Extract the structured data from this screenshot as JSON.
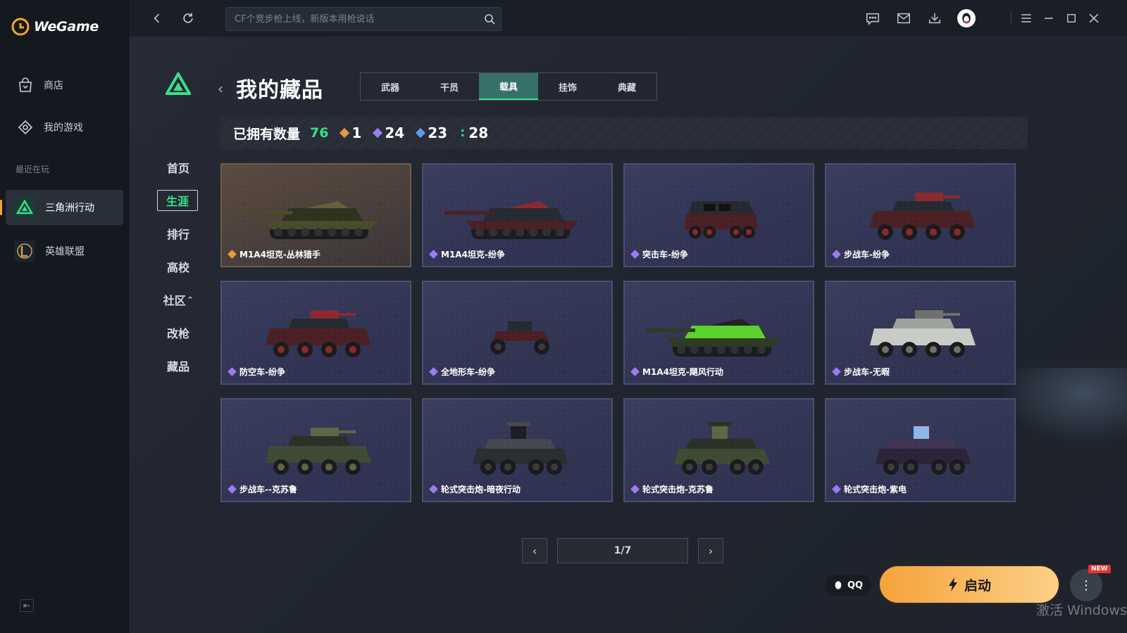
{
  "app": {
    "name": "WeGame"
  },
  "sidebar": {
    "items": [
      {
        "label": "商店",
        "icon": "shop-bag-icon"
      },
      {
        "label": "我的游戏",
        "icon": "my-games-icon"
      }
    ],
    "recent_label": "最近在玩",
    "recent": [
      {
        "label": "三角洲行动",
        "icon": "delta-force-icon",
        "active": true
      },
      {
        "label": "英雄联盟",
        "icon": "league-of-legends-icon",
        "active": false
      }
    ]
  },
  "topbar": {
    "search_placeholder": "CF个竞步枪上线，新版本用枪说话"
  },
  "game_nav": {
    "items": [
      "首页",
      "生涯",
      "排行",
      "高校",
      "社区",
      "改枪",
      "藏品"
    ],
    "active": "生涯"
  },
  "page": {
    "title": "我的藏品",
    "tabs": [
      "武器",
      "干员",
      "载具",
      "挂饰",
      "典藏"
    ],
    "active_tab": "载具"
  },
  "stats": {
    "label": "已拥有数量",
    "total": "76",
    "tiers": [
      {
        "count": "1",
        "color": "#e59a3d"
      },
      {
        "count": "24",
        "color": "#9a7cf0"
      },
      {
        "count": "23",
        "color": "#5f9ae8"
      },
      {
        "count": "28",
        "color": "#37d08a"
      }
    ]
  },
  "items": [
    {
      "name": "M1A4坦克-丛林猎手",
      "tier_color": "#e59a3d",
      "gold": true,
      "kind": "tank",
      "camo": "jungle"
    },
    {
      "name": "M1A4坦克-纷争",
      "tier_color": "#9a7cf0",
      "gold": false,
      "kind": "tank",
      "camo": "red"
    },
    {
      "name": "突击车-纷争",
      "tier_color": "#9a7cf0",
      "gold": false,
      "kind": "jeep",
      "camo": "red"
    },
    {
      "name": "步战车-纷争",
      "tier_color": "#9a7cf0",
      "gold": false,
      "kind": "ifv",
      "camo": "red"
    },
    {
      "name": "防空车-纷争",
      "tier_color": "#9a7cf0",
      "gold": false,
      "kind": "ifv",
      "camo": "red"
    },
    {
      "name": "全地形车-纷争",
      "tier_color": "#9a7cf0",
      "gold": false,
      "kind": "atv",
      "camo": "red"
    },
    {
      "name": "M1A4坦克-飓风行动",
      "tier_color": "#9a7cf0",
      "gold": false,
      "kind": "tank",
      "camo": "green"
    },
    {
      "name": "步战车-无暇",
      "tier_color": "#9a7cf0",
      "gold": false,
      "kind": "ifv",
      "camo": "white"
    },
    {
      "name": "步战车--克苏鲁",
      "tier_color": "#9a7cf0",
      "gold": false,
      "kind": "ifv",
      "camo": "swamp"
    },
    {
      "name": "轮式突击炮-暗夜行动",
      "tier_color": "#9a7cf0",
      "gold": false,
      "kind": "apc",
      "camo": "dark"
    },
    {
      "name": "轮式突击炮-克苏鲁",
      "tier_color": "#9a7cf0",
      "gold": false,
      "kind": "apc",
      "camo": "swamp"
    },
    {
      "name": "轮式突击炮-紫电",
      "tier_color": "#9a7cf0",
      "gold": false,
      "kind": "apc",
      "camo": "purple"
    }
  ],
  "pager": {
    "page": "1/7"
  },
  "actions": {
    "qq_label": "QQ",
    "launch_label": "启动",
    "new_badge": "NEW"
  },
  "watermark": "激活 Windows"
}
